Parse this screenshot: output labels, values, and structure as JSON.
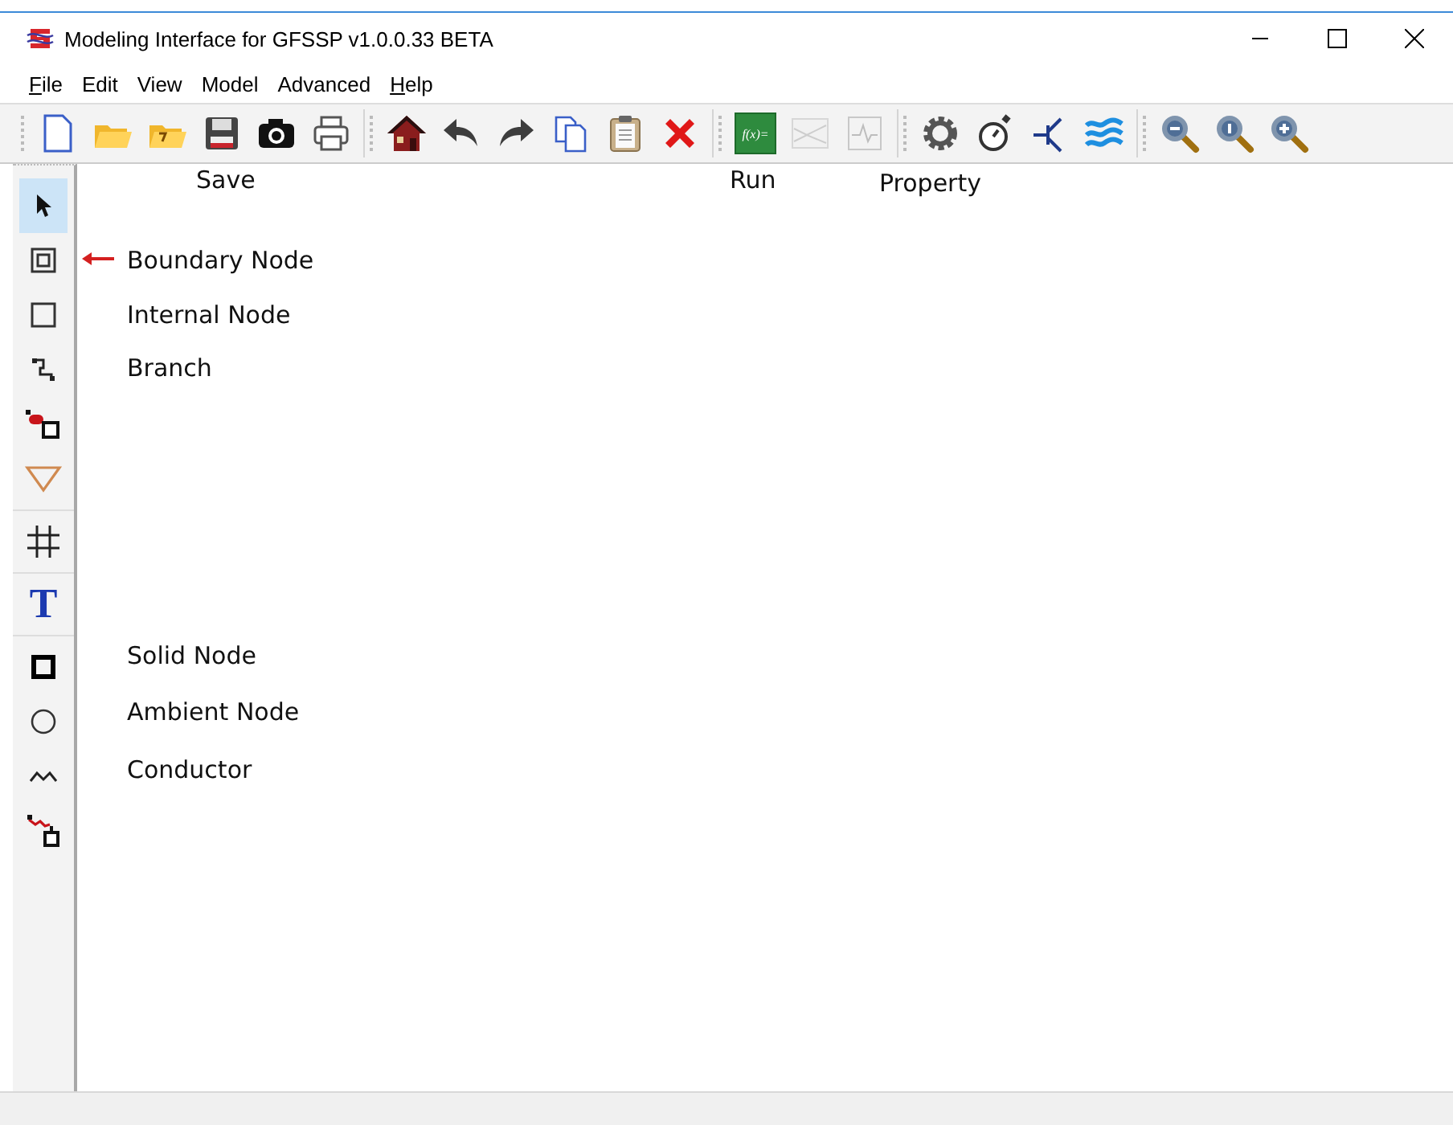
{
  "window": {
    "title": "Modeling Interface for GFSSP v1.0.0.33 BETA"
  },
  "menu": [
    {
      "label": "File",
      "mnemonic": true
    },
    {
      "label": "Edit",
      "mnemonic": false
    },
    {
      "label": "View",
      "mnemonic": false
    },
    {
      "label": "Model",
      "mnemonic": false
    },
    {
      "label": "Advanced",
      "mnemonic": false
    },
    {
      "label": "Help",
      "mnemonic": true
    }
  ],
  "toolbar": [
    [
      {
        "kind": "new",
        "disabled": false
      },
      {
        "kind": "open",
        "disabled": false
      },
      {
        "kind": "open-recent",
        "disabled": false
      },
      {
        "kind": "save",
        "disabled": false
      },
      {
        "kind": "camera",
        "disabled": false
      },
      {
        "kind": "print",
        "disabled": false
      }
    ],
    [
      {
        "kind": "home",
        "disabled": false
      },
      {
        "kind": "undo",
        "disabled": false
      },
      {
        "kind": "redo",
        "disabled": false
      },
      {
        "kind": "copy",
        "disabled": false
      },
      {
        "kind": "paste",
        "disabled": false
      },
      {
        "kind": "delete",
        "disabled": false
      }
    ],
    [
      {
        "kind": "run",
        "label": "f(x)=",
        "disabled": false
      },
      {
        "kind": "plot",
        "disabled": true
      },
      {
        "kind": "chart",
        "disabled": true
      }
    ],
    [
      {
        "kind": "gear",
        "disabled": false
      },
      {
        "kind": "stopwatch",
        "disabled": false
      },
      {
        "kind": "transistor",
        "disabled": false
      },
      {
        "kind": "waves",
        "disabled": false
      }
    ],
    [
      {
        "kind": "zoom-out",
        "disabled": false
      },
      {
        "kind": "zoom-reset",
        "disabled": false
      },
      {
        "kind": "zoom-in",
        "disabled": false
      }
    ]
  ],
  "tools": [
    [
      {
        "kind": "pointer",
        "selected": true
      },
      {
        "kind": "boundary-node",
        "selected": false
      },
      {
        "kind": "internal-node",
        "selected": false
      },
      {
        "kind": "branch",
        "selected": false
      },
      {
        "kind": "component",
        "selected": false
      },
      {
        "kind": "triangle",
        "selected": false
      }
    ],
    [
      {
        "kind": "grid",
        "selected": false
      }
    ],
    [
      {
        "kind": "text",
        "label": "T",
        "selected": false
      }
    ],
    [
      {
        "kind": "solid-node",
        "selected": false
      },
      {
        "kind": "ambient-node",
        "selected": false
      },
      {
        "kind": "conductor",
        "selected": false
      },
      {
        "kind": "connector",
        "selected": false
      }
    ]
  ],
  "annotations": [
    {
      "text": "Save"
    },
    {
      "text": "Run"
    },
    {
      "text": "Property"
    },
    {
      "text": "Boundary Node"
    },
    {
      "text": "Internal Node"
    },
    {
      "text": "Branch"
    },
    {
      "text": "Solid Node"
    },
    {
      "text": "Ambient Node"
    },
    {
      "text": "Conductor"
    }
  ]
}
